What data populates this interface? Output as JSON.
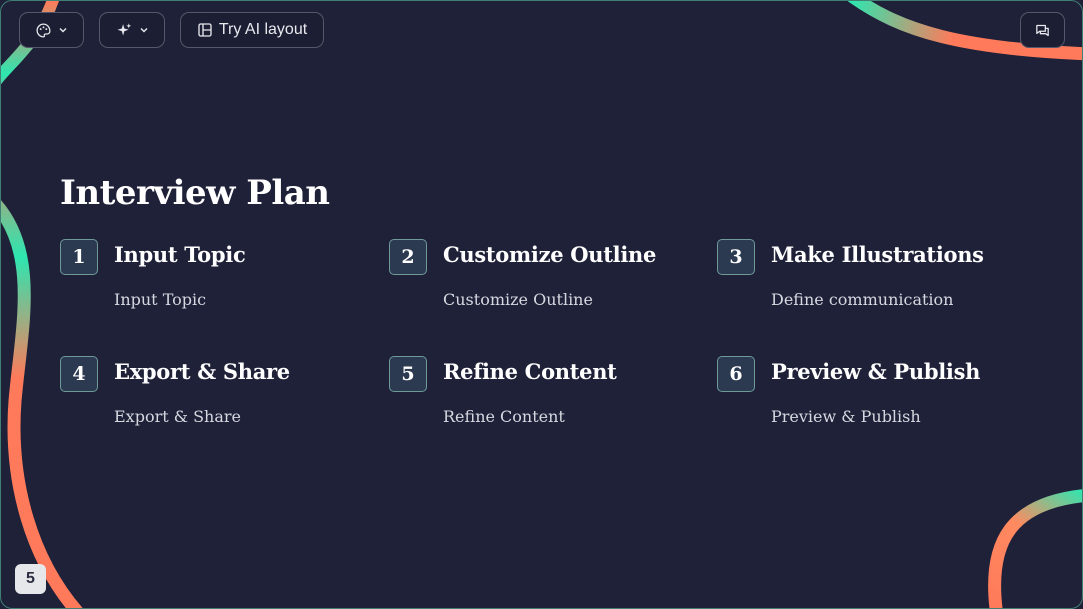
{
  "toolbar": {
    "theme_icon": "palette-icon",
    "ai_icon": "sparkle-icon",
    "layout_icon": "layout-icon",
    "layout_label": "Try AI layout",
    "comment_icon": "comment-icon"
  },
  "slide": {
    "title": "Interview Plan",
    "steps": [
      {
        "number": "1",
        "heading": "Input Topic",
        "description": "Input Topic"
      },
      {
        "number": "2",
        "heading": "Customize Outline",
        "description": "Customize Outline"
      },
      {
        "number": "3",
        "heading": "Make Illustrations",
        "description": "Define communication"
      },
      {
        "number": "4",
        "heading": "Export & Share",
        "description": "Export & Share"
      },
      {
        "number": "5",
        "heading": "Refine Content",
        "description": "Refine Content"
      },
      {
        "number": "6",
        "heading": "Preview & Publish",
        "description": "Preview & Publish"
      }
    ]
  },
  "page_number": "5",
  "colors": {
    "background": "#1f2139",
    "accent_coral": "#ff7a5a",
    "accent_mint": "#2ee6b0",
    "number_box": "#2b3a50"
  }
}
